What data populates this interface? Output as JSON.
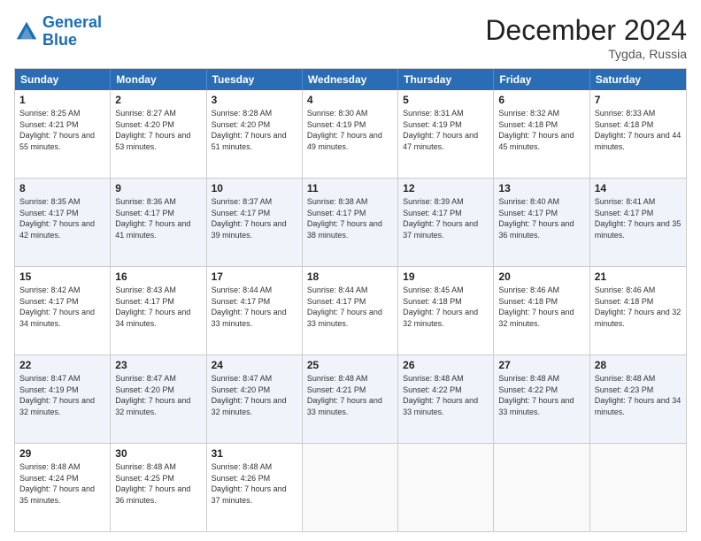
{
  "header": {
    "logo_general": "General",
    "logo_blue": "Blue",
    "month_title": "December 2024",
    "location": "Tygda, Russia"
  },
  "weekdays": [
    "Sunday",
    "Monday",
    "Tuesday",
    "Wednesday",
    "Thursday",
    "Friday",
    "Saturday"
  ],
  "rows": [
    [
      {
        "day": "1",
        "sunrise": "Sunrise: 8:25 AM",
        "sunset": "Sunset: 4:21 PM",
        "daylight": "Daylight: 7 hours and 55 minutes."
      },
      {
        "day": "2",
        "sunrise": "Sunrise: 8:27 AM",
        "sunset": "Sunset: 4:20 PM",
        "daylight": "Daylight: 7 hours and 53 minutes."
      },
      {
        "day": "3",
        "sunrise": "Sunrise: 8:28 AM",
        "sunset": "Sunset: 4:20 PM",
        "daylight": "Daylight: 7 hours and 51 minutes."
      },
      {
        "day": "4",
        "sunrise": "Sunrise: 8:30 AM",
        "sunset": "Sunset: 4:19 PM",
        "daylight": "Daylight: 7 hours and 49 minutes."
      },
      {
        "day": "5",
        "sunrise": "Sunrise: 8:31 AM",
        "sunset": "Sunset: 4:19 PM",
        "daylight": "Daylight: 7 hours and 47 minutes."
      },
      {
        "day": "6",
        "sunrise": "Sunrise: 8:32 AM",
        "sunset": "Sunset: 4:18 PM",
        "daylight": "Daylight: 7 hours and 45 minutes."
      },
      {
        "day": "7",
        "sunrise": "Sunrise: 8:33 AM",
        "sunset": "Sunset: 4:18 PM",
        "daylight": "Daylight: 7 hours and 44 minutes."
      }
    ],
    [
      {
        "day": "8",
        "sunrise": "Sunrise: 8:35 AM",
        "sunset": "Sunset: 4:17 PM",
        "daylight": "Daylight: 7 hours and 42 minutes."
      },
      {
        "day": "9",
        "sunrise": "Sunrise: 8:36 AM",
        "sunset": "Sunset: 4:17 PM",
        "daylight": "Daylight: 7 hours and 41 minutes."
      },
      {
        "day": "10",
        "sunrise": "Sunrise: 8:37 AM",
        "sunset": "Sunset: 4:17 PM",
        "daylight": "Daylight: 7 hours and 39 minutes."
      },
      {
        "day": "11",
        "sunrise": "Sunrise: 8:38 AM",
        "sunset": "Sunset: 4:17 PM",
        "daylight": "Daylight: 7 hours and 38 minutes."
      },
      {
        "day": "12",
        "sunrise": "Sunrise: 8:39 AM",
        "sunset": "Sunset: 4:17 PM",
        "daylight": "Daylight: 7 hours and 37 minutes."
      },
      {
        "day": "13",
        "sunrise": "Sunrise: 8:40 AM",
        "sunset": "Sunset: 4:17 PM",
        "daylight": "Daylight: 7 hours and 36 minutes."
      },
      {
        "day": "14",
        "sunrise": "Sunrise: 8:41 AM",
        "sunset": "Sunset: 4:17 PM",
        "daylight": "Daylight: 7 hours and 35 minutes."
      }
    ],
    [
      {
        "day": "15",
        "sunrise": "Sunrise: 8:42 AM",
        "sunset": "Sunset: 4:17 PM",
        "daylight": "Daylight: 7 hours and 34 minutes."
      },
      {
        "day": "16",
        "sunrise": "Sunrise: 8:43 AM",
        "sunset": "Sunset: 4:17 PM",
        "daylight": "Daylight: 7 hours and 34 minutes."
      },
      {
        "day": "17",
        "sunrise": "Sunrise: 8:44 AM",
        "sunset": "Sunset: 4:17 PM",
        "daylight": "Daylight: 7 hours and 33 minutes."
      },
      {
        "day": "18",
        "sunrise": "Sunrise: 8:44 AM",
        "sunset": "Sunset: 4:17 PM",
        "daylight": "Daylight: 7 hours and 33 minutes."
      },
      {
        "day": "19",
        "sunrise": "Sunrise: 8:45 AM",
        "sunset": "Sunset: 4:18 PM",
        "daylight": "Daylight: 7 hours and 32 minutes."
      },
      {
        "day": "20",
        "sunrise": "Sunrise: 8:46 AM",
        "sunset": "Sunset: 4:18 PM",
        "daylight": "Daylight: 7 hours and 32 minutes."
      },
      {
        "day": "21",
        "sunrise": "Sunrise: 8:46 AM",
        "sunset": "Sunset: 4:18 PM",
        "daylight": "Daylight: 7 hours and 32 minutes."
      }
    ],
    [
      {
        "day": "22",
        "sunrise": "Sunrise: 8:47 AM",
        "sunset": "Sunset: 4:19 PM",
        "daylight": "Daylight: 7 hours and 32 minutes."
      },
      {
        "day": "23",
        "sunrise": "Sunrise: 8:47 AM",
        "sunset": "Sunset: 4:20 PM",
        "daylight": "Daylight: 7 hours and 32 minutes."
      },
      {
        "day": "24",
        "sunrise": "Sunrise: 8:47 AM",
        "sunset": "Sunset: 4:20 PM",
        "daylight": "Daylight: 7 hours and 32 minutes."
      },
      {
        "day": "25",
        "sunrise": "Sunrise: 8:48 AM",
        "sunset": "Sunset: 4:21 PM",
        "daylight": "Daylight: 7 hours and 33 minutes."
      },
      {
        "day": "26",
        "sunrise": "Sunrise: 8:48 AM",
        "sunset": "Sunset: 4:22 PM",
        "daylight": "Daylight: 7 hours and 33 minutes."
      },
      {
        "day": "27",
        "sunrise": "Sunrise: 8:48 AM",
        "sunset": "Sunset: 4:22 PM",
        "daylight": "Daylight: 7 hours and 33 minutes."
      },
      {
        "day": "28",
        "sunrise": "Sunrise: 8:48 AM",
        "sunset": "Sunset: 4:23 PM",
        "daylight": "Daylight: 7 hours and 34 minutes."
      }
    ],
    [
      {
        "day": "29",
        "sunrise": "Sunrise: 8:48 AM",
        "sunset": "Sunset: 4:24 PM",
        "daylight": "Daylight: 7 hours and 35 minutes."
      },
      {
        "day": "30",
        "sunrise": "Sunrise: 8:48 AM",
        "sunset": "Sunset: 4:25 PM",
        "daylight": "Daylight: 7 hours and 36 minutes."
      },
      {
        "day": "31",
        "sunrise": "Sunrise: 8:48 AM",
        "sunset": "Sunset: 4:26 PM",
        "daylight": "Daylight: 7 hours and 37 minutes."
      },
      null,
      null,
      null,
      null
    ]
  ]
}
